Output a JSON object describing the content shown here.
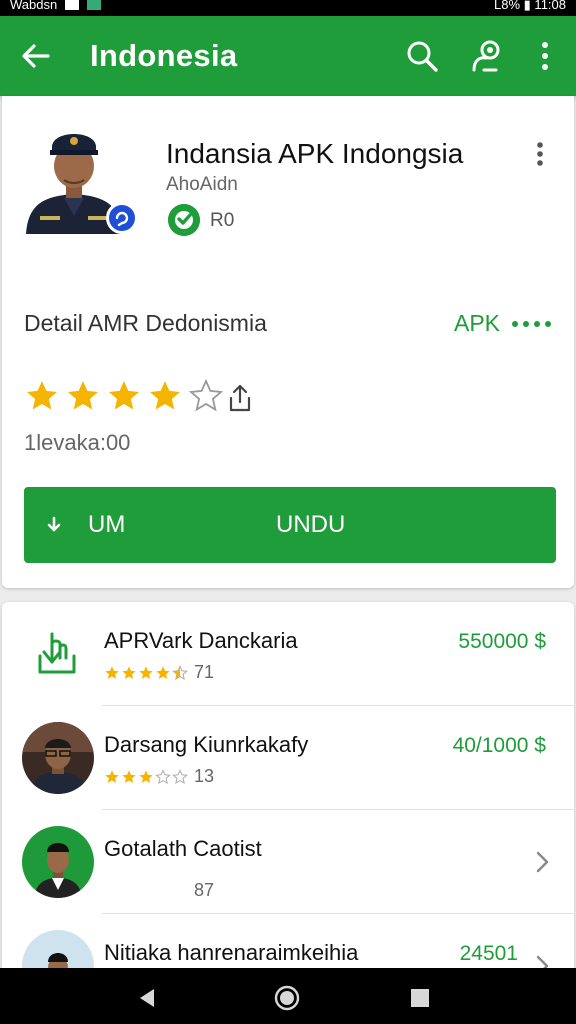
{
  "status_bar": {
    "left_text": "Wabdsn",
    "right_text": "L8% ▮ 11:08"
  },
  "app_bar": {
    "title": "Indonesia"
  },
  "app": {
    "name": "Indansia APK Indongsia",
    "developer": "AhoAidn",
    "content_rating": "R0",
    "detail_label": "Detail AMR Dedonismia",
    "apk_label": "APK",
    "rating_stars": 4,
    "downloads": "1levaka:00",
    "install_left": "UM",
    "install_right": "UNDU"
  },
  "list": [
    {
      "name": "APRVark Danckaria",
      "rating_text": "71",
      "stars": 4.5,
      "price": "550000 $"
    },
    {
      "name": "Darsang Kiunrkakafy",
      "rating_text": "13",
      "stars": 3,
      "price": "40/1000 $"
    },
    {
      "name": "Gotalath Caotist",
      "sub": "87"
    },
    {
      "name": "Nitiaka hanrenaraimkeihia",
      "price": "24501"
    }
  ],
  "colors": {
    "primary": "#1f9d3a",
    "star": "#f4b400"
  },
  "icons": [
    "arrow-back-icon",
    "search-icon",
    "account-icon",
    "more-vert-icon",
    "share-icon",
    "download-icon",
    "chevron-right-icon",
    "nav-back-icon",
    "nav-home-icon",
    "nav-recents-icon"
  ]
}
